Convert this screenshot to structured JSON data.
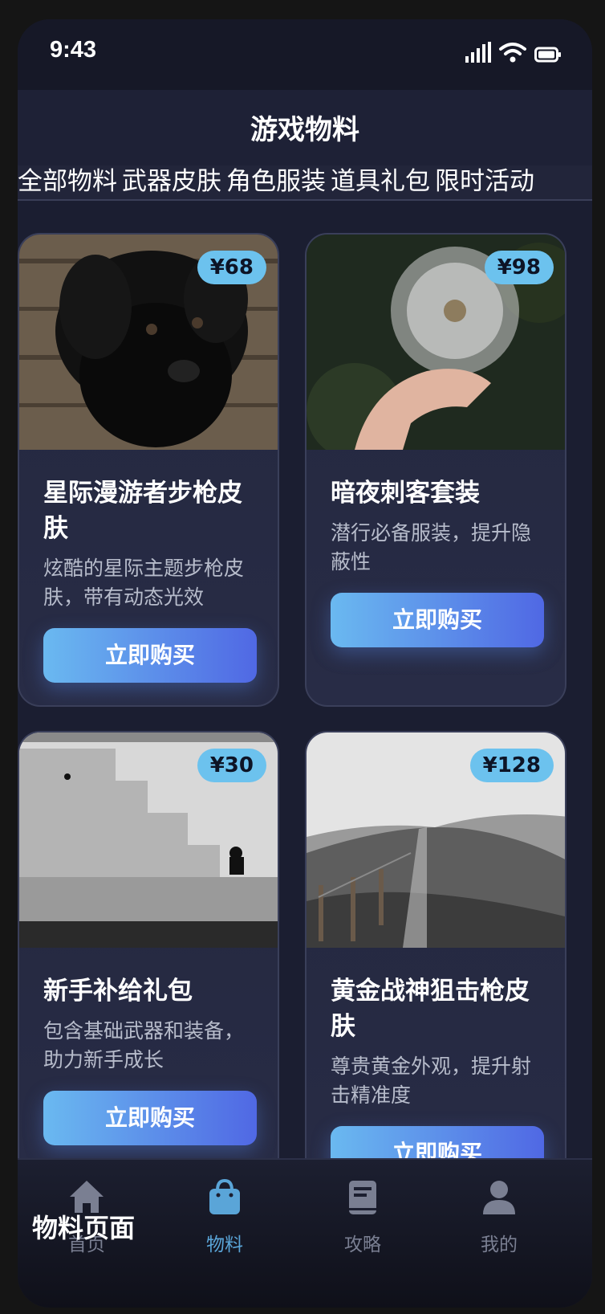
{
  "status_bar": {
    "time": "9:43"
  },
  "header": {
    "title": "游戏物料"
  },
  "filters": [
    "全部物料",
    "武器皮肤",
    "角色服装",
    "道具礼包",
    "限时活动"
  ],
  "cards": [
    {
      "price": "¥68",
      "title": "星际漫游者步枪皮肤",
      "desc": "炫酷的星际主题步枪皮肤，带有动态光效",
      "button": "立即购买",
      "image": "black-puppy"
    },
    {
      "price": "¥98",
      "title": "暗夜刺客套装",
      "desc": "潜行必备服装，提升隐蔽性",
      "button": "立即购买",
      "image": "dandelion"
    },
    {
      "price": "¥30",
      "title": "新手补给礼包",
      "desc": "包含基础武器和装备，助力新手成长",
      "button": "立即购买",
      "image": "stone-stairs"
    },
    {
      "price": "¥128",
      "title": "黄金战神狙击枪皮肤",
      "desc": "尊贵黄金外观，提升射击精准度",
      "button": "立即购买",
      "image": "hill-fence-path"
    }
  ],
  "bottom_nav": {
    "items": [
      {
        "label": "首页",
        "icon": "home-icon"
      },
      {
        "label": "物料",
        "icon": "bag-icon",
        "active": true
      },
      {
        "label": "攻略",
        "icon": "book-icon"
      },
      {
        "label": "我的",
        "icon": "user-icon"
      }
    ]
  },
  "page_label": "物料页面",
  "colors": {
    "accent": "#5aa5d8",
    "price_badge": "#6cc2ee",
    "button_start": "#6ab9f0",
    "button_end": "#5068e4",
    "background": "#1b1e31"
  }
}
